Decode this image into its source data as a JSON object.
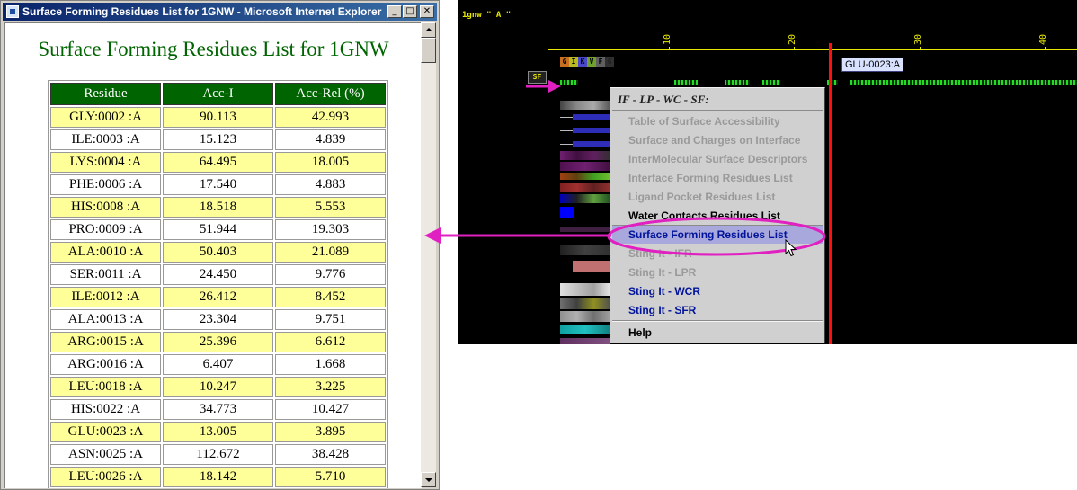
{
  "window": {
    "title": "Surface Forming Residues List for 1GNW - Microsoft Internet Explorer",
    "min_glyph": "_",
    "max_glyph": "□",
    "close_glyph": "✕"
  },
  "page": {
    "heading": "Surface Forming Residues List for 1GNW",
    "columns": [
      "Residue",
      "Acc-I",
      "Acc-Rel (%)"
    ],
    "rows": [
      {
        "residue": "GLY:0002 :A",
        "acc_i": "90.113",
        "acc_rel": "42.993",
        "highlight": true
      },
      {
        "residue": "ILE:0003 :A",
        "acc_i": "15.123",
        "acc_rel": "4.839",
        "highlight": false
      },
      {
        "residue": "LYS:0004 :A",
        "acc_i": "64.495",
        "acc_rel": "18.005",
        "highlight": true
      },
      {
        "residue": "PHE:0006 :A",
        "acc_i": "17.540",
        "acc_rel": "4.883",
        "highlight": false
      },
      {
        "residue": "HIS:0008 :A",
        "acc_i": "18.518",
        "acc_rel": "5.553",
        "highlight": true
      },
      {
        "residue": "PRO:0009 :A",
        "acc_i": "51.944",
        "acc_rel": "19.303",
        "highlight": false
      },
      {
        "residue": "ALA:0010 :A",
        "acc_i": "50.403",
        "acc_rel": "21.089",
        "highlight": true
      },
      {
        "residue": "SER:0011 :A",
        "acc_i": "24.450",
        "acc_rel": "9.776",
        "highlight": false
      },
      {
        "residue": "ILE:0012 :A",
        "acc_i": "26.412",
        "acc_rel": "8.452",
        "highlight": true
      },
      {
        "residue": "ALA:0013 :A",
        "acc_i": "23.304",
        "acc_rel": "9.751",
        "highlight": false
      },
      {
        "residue": "ARG:0015 :A",
        "acc_i": "25.396",
        "acc_rel": "6.612",
        "highlight": true
      },
      {
        "residue": "ARG:0016 :A",
        "acc_i": "6.407",
        "acc_rel": "1.668",
        "highlight": false
      },
      {
        "residue": "LEU:0018 :A",
        "acc_i": "10.247",
        "acc_rel": "3.225",
        "highlight": true
      },
      {
        "residue": "HIS:0022 :A",
        "acc_i": "34.773",
        "acc_rel": "10.427",
        "highlight": false
      },
      {
        "residue": "GLU:0023 :A",
        "acc_i": "13.005",
        "acc_rel": "3.895",
        "highlight": true
      },
      {
        "residue": "ASN:0025 :A",
        "acc_i": "112.672",
        "acc_rel": "38.428",
        "highlight": false
      },
      {
        "residue": "LEU:0026 :A",
        "acc_i": "18.142",
        "acc_rel": "5.710",
        "highlight": true
      }
    ]
  },
  "viewer": {
    "chain_label": "1gnw \" A \"",
    "ruler_ticks": [
      "10",
      "20",
      "30",
      "40"
    ],
    "sequence": [
      "G",
      "I",
      "K",
      "V",
      "F",
      "G"
    ],
    "sf_tag": "SF",
    "tooltip": "GLU-0023:A"
  },
  "context_menu": {
    "header": "IF - LP - WC - SF:",
    "items": [
      {
        "label": "Table of Surface Accessibility",
        "state": "disabled"
      },
      {
        "label": "Surface and Charges on Interface",
        "state": "disabled"
      },
      {
        "label": "InterMolecular Surface Descriptors",
        "state": "disabled"
      },
      {
        "label": "Interface Forming Residues List",
        "state": "disabled"
      },
      {
        "label": "Ligand Pocket Residues List",
        "state": "disabled"
      },
      {
        "label": "Water Contacts Residues List",
        "state": "enabled"
      },
      {
        "label": "Surface Forming Residues List",
        "state": "selected"
      },
      {
        "label": "Sting It - IFR",
        "state": "disabled"
      },
      {
        "label": "Sting It - LPR",
        "state": "disabled"
      },
      {
        "label": "Sting It - WCR",
        "state": "blue"
      },
      {
        "label": "Sting It - SFR",
        "state": "blue"
      }
    ],
    "help": "Help"
  },
  "colors": {
    "header_green": "#006400",
    "row_highlight": "#ffff99",
    "annotation_magenta": "#e020c0",
    "marker_red": "#ff1010"
  }
}
